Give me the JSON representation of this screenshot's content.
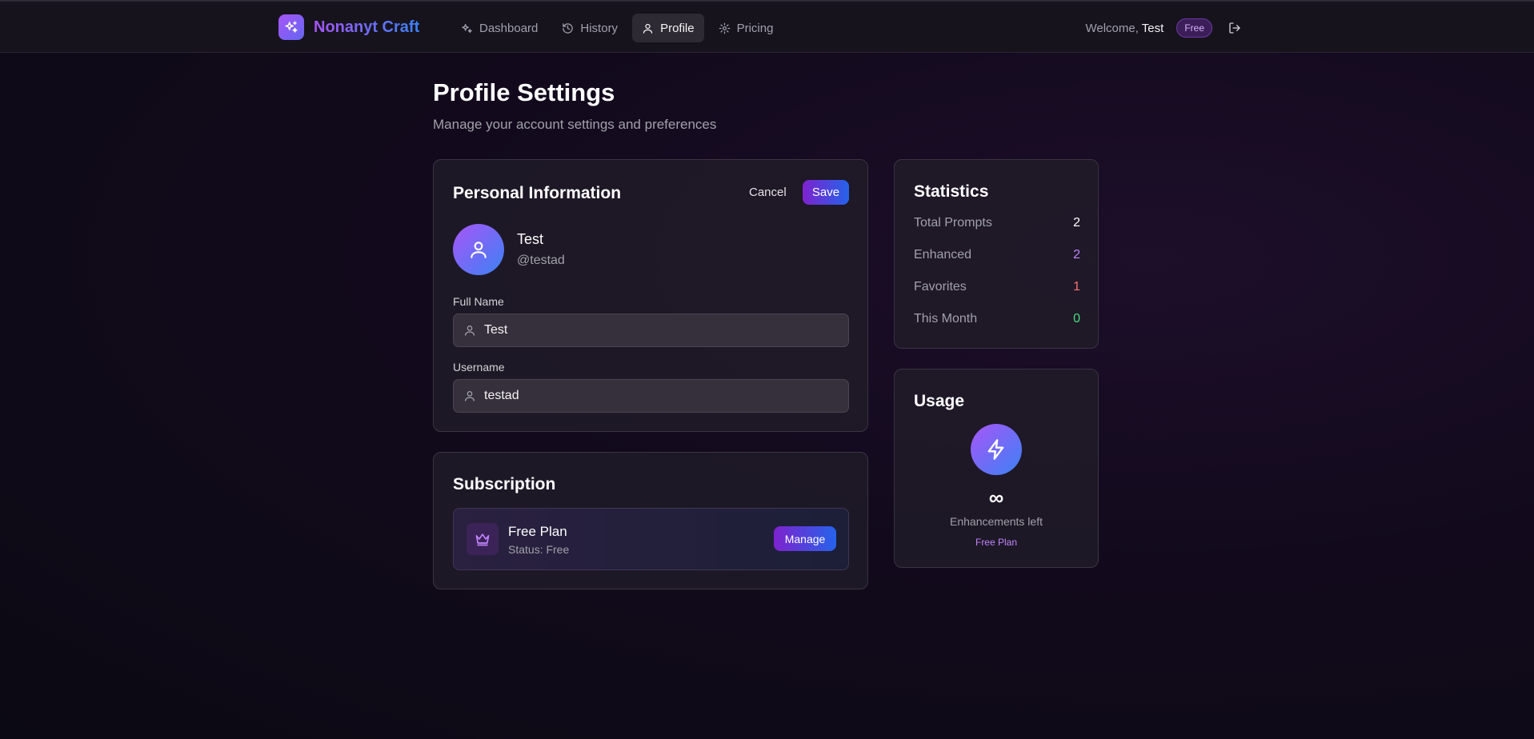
{
  "brand": {
    "name": "Nonanyt Craft",
    "logo_icon": "sparkles-icon"
  },
  "nav": {
    "items": [
      {
        "label": "Dashboard",
        "icon": "sparkles-icon",
        "active": false
      },
      {
        "label": "History",
        "icon": "history-icon",
        "active": false
      },
      {
        "label": "Profile",
        "icon": "user-icon",
        "active": true
      },
      {
        "label": "Pricing",
        "icon": "gear-icon",
        "active": false
      }
    ]
  },
  "user": {
    "welcome_prefix": "Welcome,",
    "name": "Test",
    "tier": "Free"
  },
  "page": {
    "title": "Profile Settings",
    "subtitle": "Manage your account settings and preferences"
  },
  "personal": {
    "title": "Personal Information",
    "cancel_label": "Cancel",
    "save_label": "Save",
    "display_name": "Test",
    "handle": "@testad",
    "full_name_label": "Full Name",
    "full_name_value": "Test",
    "username_label": "Username",
    "username_value": "testad"
  },
  "subscription": {
    "title": "Subscription",
    "plan_name": "Free Plan",
    "plan_status": "Status: Free",
    "manage_label": "Manage",
    "icon": "crown-icon"
  },
  "statistics": {
    "title": "Statistics",
    "rows": [
      {
        "label": "Total Prompts",
        "value": "2",
        "color": "#ffffff"
      },
      {
        "label": "Enhanced",
        "value": "2",
        "color": "#c084fc"
      },
      {
        "label": "Favorites",
        "value": "1",
        "color": "#f87171"
      },
      {
        "label": "This Month",
        "value": "0",
        "color": "#4ade80"
      }
    ]
  },
  "usage": {
    "title": "Usage",
    "icon": "lightning-icon",
    "value": "∞",
    "caption": "Enhancements left",
    "plan": "Free Plan"
  },
  "colors": {
    "accent_purple": "#7e22ce",
    "accent_blue": "#2563eb",
    "background": "#0b0913"
  }
}
